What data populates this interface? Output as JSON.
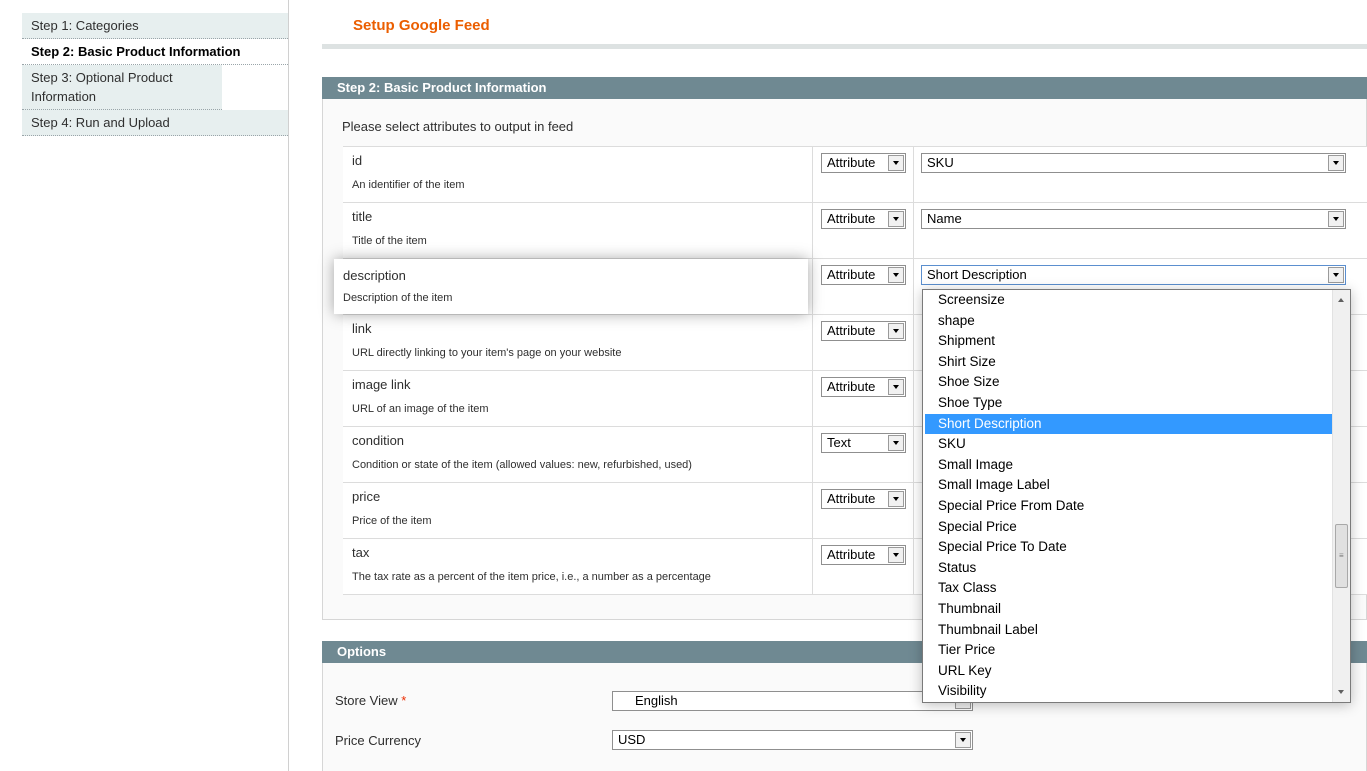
{
  "sidebar": {
    "items": [
      {
        "label": "Step 1: Categories"
      },
      {
        "label": "Step 2: Basic Product Information"
      },
      {
        "label": "Step 3: Optional Product Information"
      },
      {
        "label": "Step 4: Run and Upload"
      }
    ]
  },
  "page": {
    "title": "Setup Google Feed"
  },
  "basic": {
    "heading": "Step 2: Basic Product Information",
    "hint": "Please select attributes to output in feed",
    "rows": [
      {
        "name": "id",
        "desc": "An identifier of the item",
        "type": "Attribute",
        "value": "SKU"
      },
      {
        "name": "title",
        "desc": "Title of the item",
        "type": "Attribute",
        "value": "Name"
      },
      {
        "name": "description",
        "desc": "Description of the item",
        "type": "Attribute",
        "value": "Short Description"
      },
      {
        "name": "link",
        "desc": "URL directly linking to your item's page on your website",
        "type": "Attribute",
        "value": ""
      },
      {
        "name": "image link",
        "desc": "URL of an image of the item",
        "type": "Attribute",
        "value": ""
      },
      {
        "name": "condition",
        "desc": "Condition or state of the item (allowed values: new, refurbished, used)",
        "type": "Text",
        "value": ""
      },
      {
        "name": "price",
        "desc": "Price of the item",
        "type": "Attribute",
        "value": ""
      },
      {
        "name": "tax",
        "desc": "The tax rate as a percent of the item price, i.e., a number as a percentage",
        "type": "Attribute",
        "value": ""
      }
    ]
  },
  "dropdown": {
    "options": [
      "Screensize",
      "shape",
      "Shipment",
      "Shirt Size",
      "Shoe Size",
      "Shoe Type",
      "Short Description",
      "SKU",
      "Small Image",
      "Small Image Label",
      "Special Price From Date",
      "Special Price",
      "Special Price To Date",
      "Status",
      "Tax Class",
      "Thumbnail",
      "Thumbnail Label",
      "Tier Price",
      "URL Key",
      "Visibility"
    ],
    "selected": "Short Description"
  },
  "options": {
    "heading": "Options",
    "store_view_label": "Store View",
    "required_mark": "*",
    "store_view_value": "English",
    "price_currency_label": "Price Currency",
    "price_currency_value": "USD"
  },
  "colors": {
    "title_orange": "#eb5e00",
    "section_header": "#6f8992",
    "highlight": "#3399ff"
  }
}
